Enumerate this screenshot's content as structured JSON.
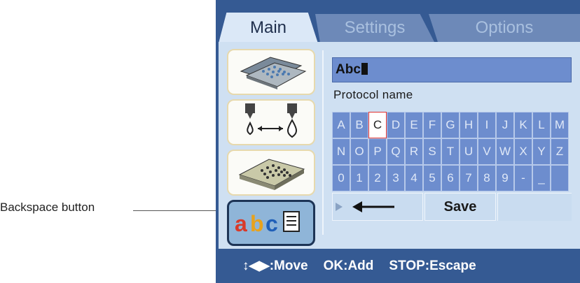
{
  "callout": {
    "label": "Backspace button"
  },
  "tabs": [
    {
      "label": "Main",
      "active": true
    },
    {
      "label": "Settings",
      "active": false
    },
    {
      "label": "Options",
      "active": false
    }
  ],
  "sidebar": {
    "items": [
      {
        "icon": "microplate-stack-icon"
      },
      {
        "icon": "dispense-transfer-icon"
      },
      {
        "icon": "microplate-icon"
      },
      {
        "icon": "text-edit-icon",
        "text": "abc",
        "selected": true
      }
    ]
  },
  "editor": {
    "field_value": "Abc",
    "field_label": "Protocol name",
    "keyboard_rows": [
      [
        "A",
        "B",
        "C",
        "D",
        "E",
        "F",
        "G",
        "H",
        "I",
        "J",
        "K",
        "L",
        "M"
      ],
      [
        "N",
        "O",
        "P",
        "Q",
        "R",
        "S",
        "T",
        "U",
        "V",
        "W",
        "X",
        "Y",
        "Z"
      ],
      [
        "0",
        "1",
        "2",
        "3",
        "4",
        "5",
        "6",
        "7",
        "8",
        "9",
        "-",
        "_",
        ""
      ]
    ],
    "active_key": "C",
    "backspace_icon": "left-arrow-icon",
    "save_label": "Save"
  },
  "footer": {
    "move_hint": "↕◀▶:Move",
    "add_hint": "OK:Add",
    "escape_hint": "STOP:Escape"
  },
  "colors": {
    "frame": "#355a93",
    "key": "#6d8dce",
    "active_key_border": "#e03030"
  }
}
